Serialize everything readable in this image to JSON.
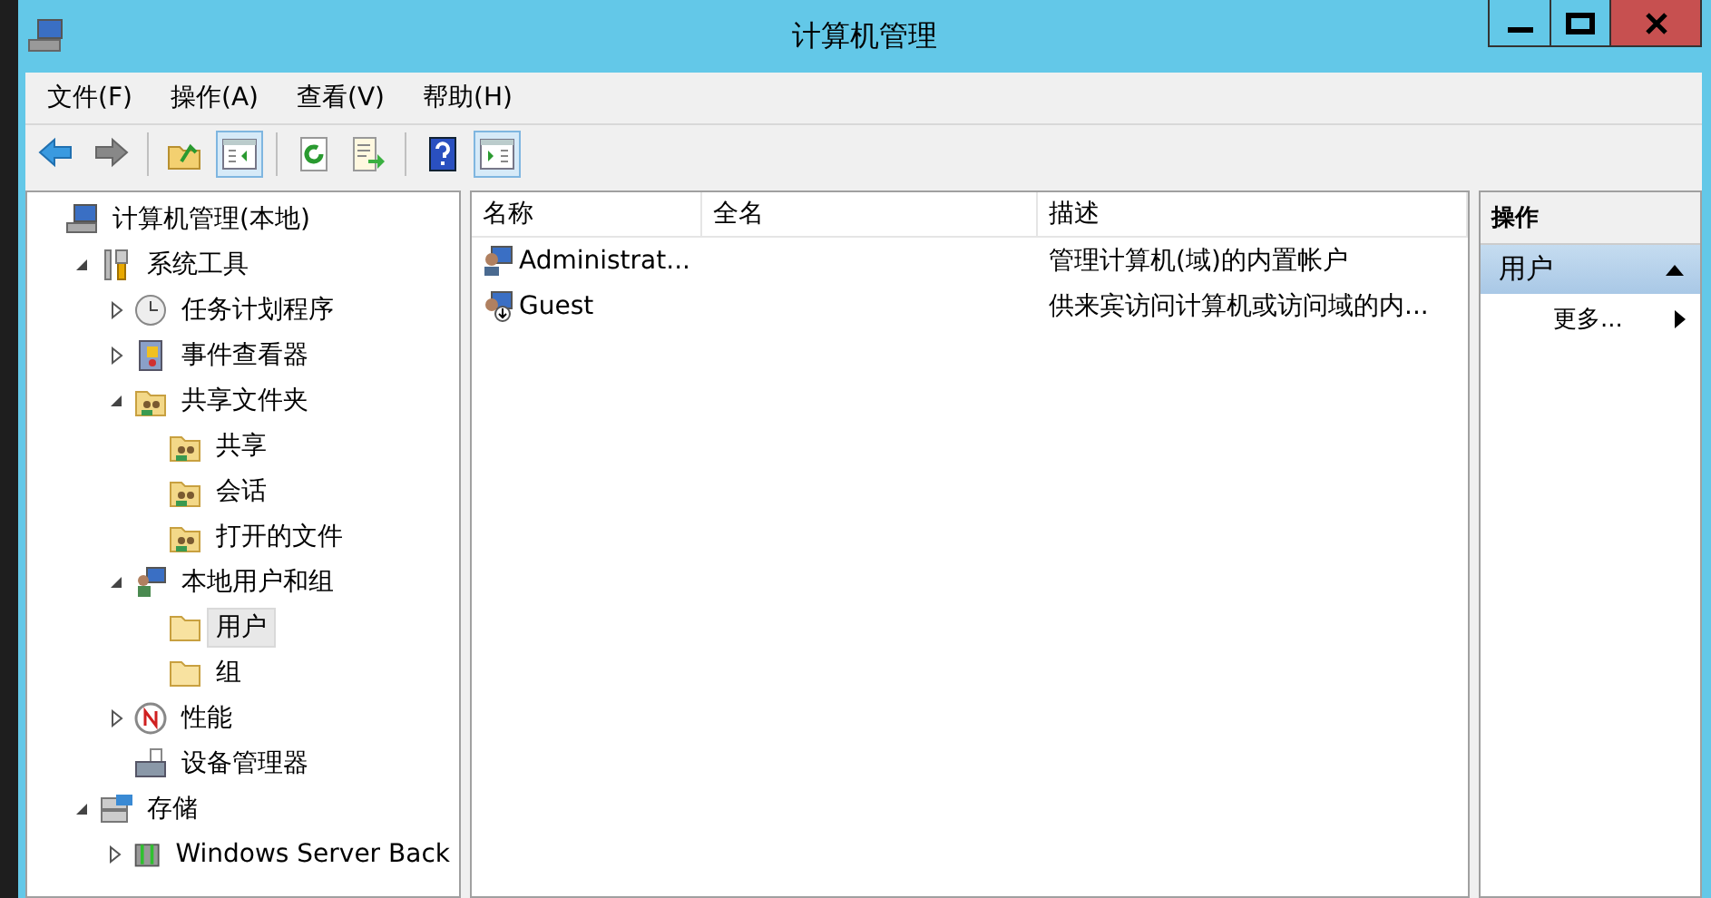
{
  "window": {
    "title": "计算机管理"
  },
  "menu": [
    "文件(F)",
    "操作(A)",
    "查看(V)",
    "帮助(H)"
  ],
  "toolbar": [
    {
      "kind": "back",
      "pressed": false
    },
    {
      "kind": "forward",
      "pressed": false
    },
    {
      "kind": "sep"
    },
    {
      "kind": "up",
      "pressed": false
    },
    {
      "kind": "tree-pane",
      "pressed": true
    },
    {
      "kind": "sep"
    },
    {
      "kind": "refresh",
      "pressed": false
    },
    {
      "kind": "export",
      "pressed": false
    },
    {
      "kind": "sep"
    },
    {
      "kind": "help",
      "pressed": false
    },
    {
      "kind": "action-pane",
      "pressed": true
    }
  ],
  "tree": [
    {
      "label": "计算机管理(本地)",
      "kind": "computer",
      "selected": false,
      "children": [
        {
          "label": "系统工具",
          "kind": "tools",
          "expanded": true,
          "selected": false,
          "children": [
            {
              "label": "任务计划程序",
              "kind": "clock",
              "expanded": false,
              "selected": false
            },
            {
              "label": "事件查看器",
              "kind": "event",
              "expanded": false,
              "selected": false
            },
            {
              "label": "共享文件夹",
              "kind": "share",
              "expanded": true,
              "selected": false,
              "children": [
                {
                  "label": "共享",
                  "kind": "share",
                  "selected": false
                },
                {
                  "label": "会话",
                  "kind": "share",
                  "selected": false
                },
                {
                  "label": "打开的文件",
                  "kind": "share",
                  "selected": false
                }
              ]
            },
            {
              "label": "本地用户和组",
              "kind": "users",
              "expanded": true,
              "selected": false,
              "children": [
                {
                  "label": "用户",
                  "kind": "folder",
                  "selected": true
                },
                {
                  "label": "组",
                  "kind": "folder",
                  "selected": false
                }
              ]
            },
            {
              "label": "性能",
              "kind": "perf",
              "expanded": false,
              "selected": false
            },
            {
              "label": "设备管理器",
              "kind": "device",
              "selected": false
            }
          ]
        },
        {
          "label": "存储",
          "kind": "storage",
          "expanded": true,
          "selected": false,
          "children": [
            {
              "label": "Windows Server Back",
              "kind": "backup",
              "expanded": false,
              "selected": false
            }
          ]
        }
      ]
    }
  ],
  "table": {
    "columns": [
      "名称",
      "全名",
      "描述"
    ],
    "rows": [
      {
        "name": "Administrat...",
        "description": "管理计算机(域)的内置帐户",
        "kind": "user"
      },
      {
        "name": "Guest",
        "description": "供来宾访问计算机或访问域的内...",
        "kind": "guest"
      }
    ]
  },
  "actions": {
    "header": "操作",
    "section": {
      "label": "用户",
      "expanded": true
    },
    "items": [
      {
        "label": "更多..."
      }
    ]
  }
}
